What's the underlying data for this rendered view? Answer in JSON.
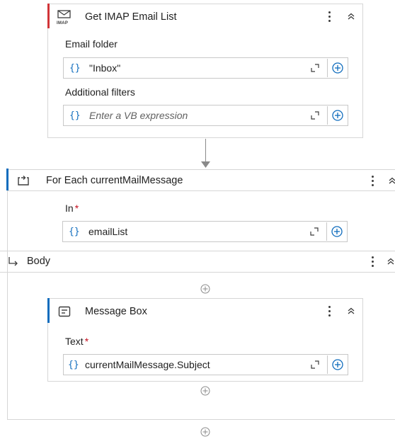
{
  "imap_activity": {
    "title": "Get IMAP Email List",
    "icon_text": "IMAP",
    "email_folder_label": "Email folder",
    "email_folder_value": "\"Inbox\"",
    "additional_filters_label": "Additional filters",
    "additional_filters_placeholder": "Enter a VB expression",
    "brace": "{}"
  },
  "for_each": {
    "title": "For Each currentMailMessage",
    "in_label": "In",
    "required_marker": "*",
    "in_value": "emailList",
    "brace": "{}"
  },
  "body": {
    "title": "Body"
  },
  "message_box": {
    "title": "Message Box",
    "text_label": "Text",
    "required_marker": "*",
    "text_value": "currentMailMessage.Subject",
    "brace": "{}"
  },
  "colors": {
    "accent_red": "#d13438",
    "accent_blue": "#0f6cbd",
    "brace_blue": "#0f6cbd",
    "border": "#d6d6d6"
  }
}
